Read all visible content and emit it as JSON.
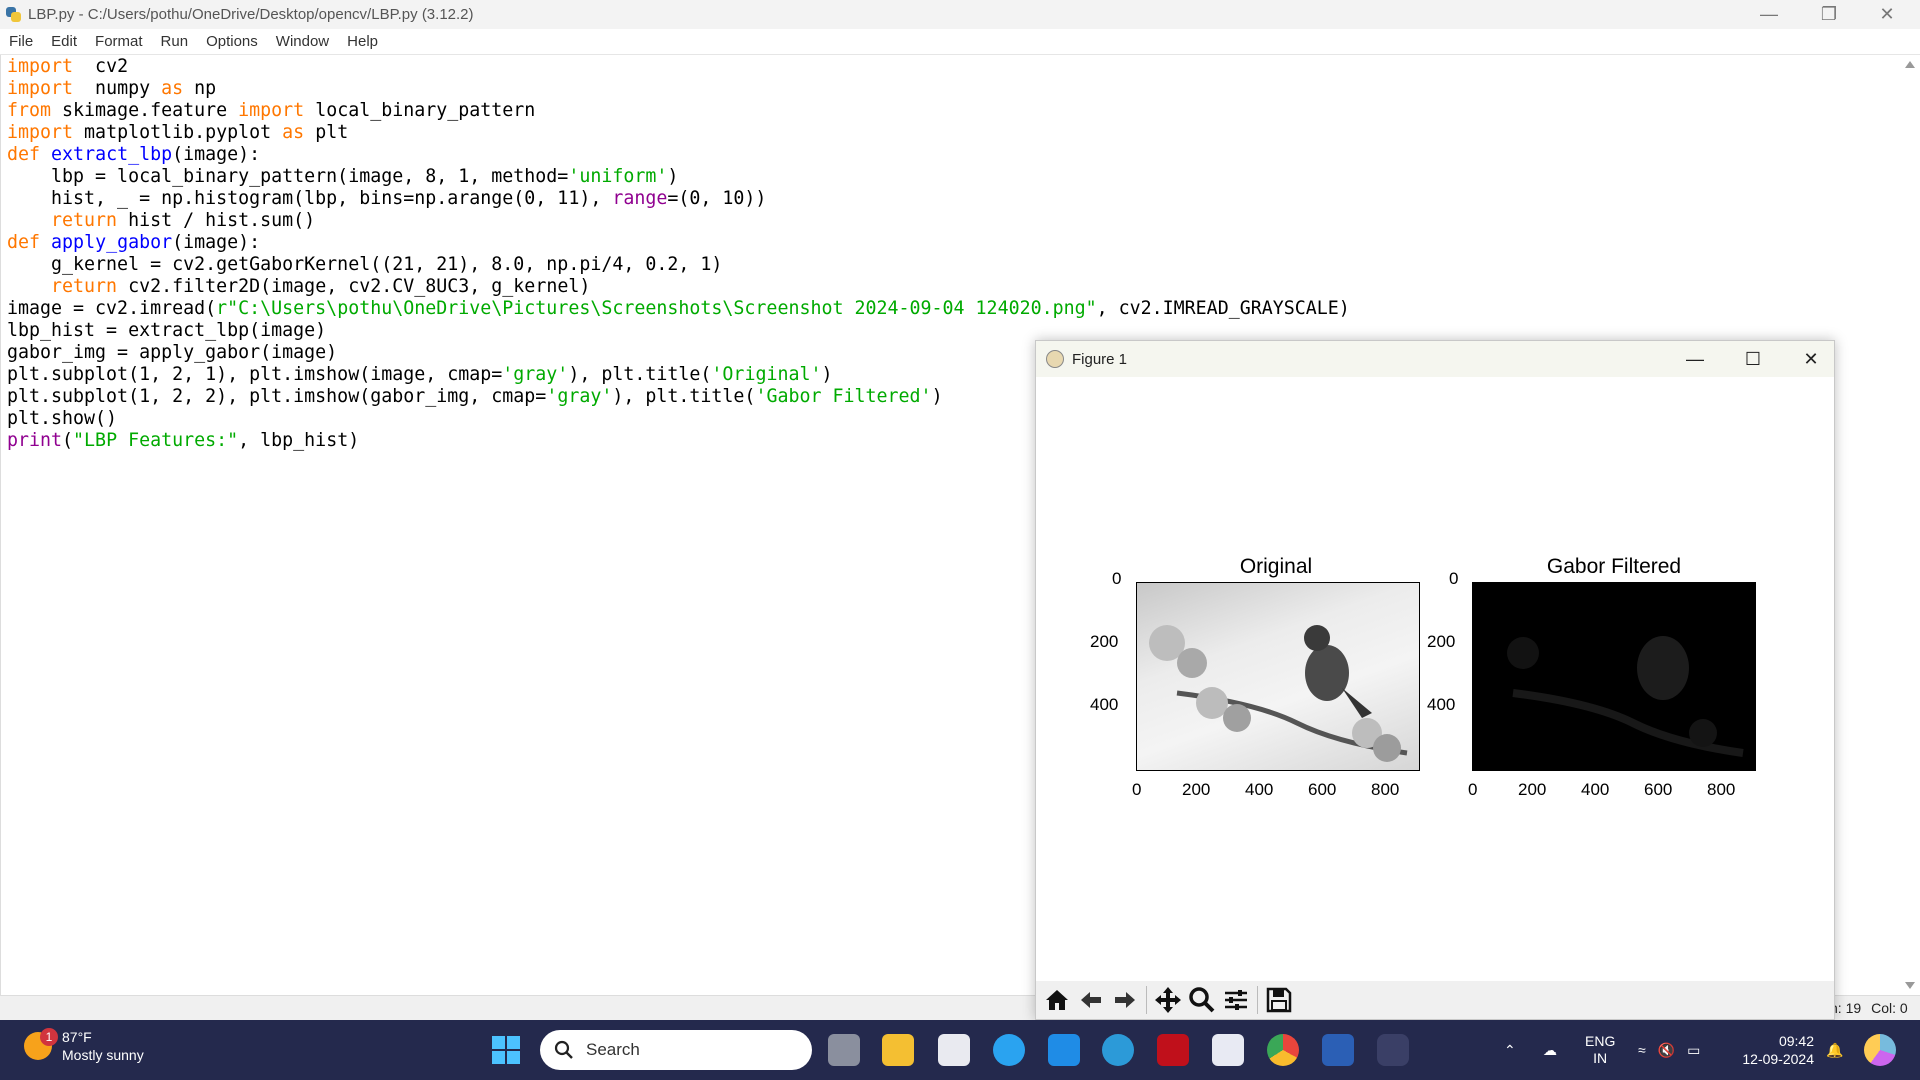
{
  "window": {
    "title": "LBP.py - C:/Users/pothu/OneDrive/Desktop/opencv/LBP.py (3.12.2)"
  },
  "menu": [
    "File",
    "Edit",
    "Format",
    "Run",
    "Options",
    "Window",
    "Help"
  ],
  "code_lines": [
    [
      [
        "kw",
        "import"
      ],
      [
        "",
        "  cv2"
      ]
    ],
    [
      [
        "kw",
        "import"
      ],
      [
        "",
        "  numpy "
      ],
      [
        "kw",
        "as"
      ],
      [
        "",
        " np"
      ]
    ],
    [
      [
        "kw",
        "from"
      ],
      [
        "",
        " skimage.feature "
      ],
      [
        "kw",
        "import"
      ],
      [
        "",
        " local_binary_pattern"
      ]
    ],
    [
      [
        "kw",
        "import"
      ],
      [
        "",
        " matplotlib.pyplot "
      ],
      [
        "kw",
        "as"
      ],
      [
        "",
        " plt"
      ]
    ],
    [
      [
        "kw",
        "def"
      ],
      [
        "",
        " "
      ],
      [
        "fn",
        "extract_lbp"
      ],
      [
        "",
        "(image):"
      ]
    ],
    [
      [
        "",
        "    lbp = local_binary_pattern(image, 8, 1, method="
      ],
      [
        "st",
        "'uniform'"
      ],
      [
        "",
        ")"
      ]
    ],
    [
      [
        "",
        "    hist, _ = np.histogram(lbp, bins=np.arange(0, 11), "
      ],
      [
        "bi",
        "range"
      ],
      [
        "",
        "=(0, 10))"
      ]
    ],
    [
      [
        "",
        "    "
      ],
      [
        "kw",
        "return"
      ],
      [
        "",
        " hist / hist.sum()"
      ]
    ],
    [
      [
        "kw",
        "def"
      ],
      [
        "",
        " "
      ],
      [
        "fn",
        "apply_gabor"
      ],
      [
        "",
        "(image):"
      ]
    ],
    [
      [
        "",
        "    g_kernel = cv2.getGaborKernel((21, 21), 8.0, np.pi/4, 0.2, 1)"
      ]
    ],
    [
      [
        "",
        "    "
      ],
      [
        "kw",
        "return"
      ],
      [
        "",
        " cv2.filter2D(image, cv2.CV_8UC3, g_kernel)"
      ]
    ],
    [
      [
        "",
        "image = cv2.imread("
      ],
      [
        "st",
        "r\"C:\\Users\\pothu\\OneDrive\\Pictures\\Screenshots\\Screenshot 2024-09-04 124020.png\""
      ],
      [
        "",
        ", cv2.IMREAD_GRAYSCALE)"
      ]
    ],
    [
      [
        "",
        "lbp_hist = extract_lbp(image)"
      ]
    ],
    [
      [
        "",
        "gabor_img = apply_gabor(image)"
      ]
    ],
    [
      [
        "",
        "plt.subplot(1, 2, 1), plt.imshow(image, cmap="
      ],
      [
        "st",
        "'gray'"
      ],
      [
        "",
        "), plt.title("
      ],
      [
        "st",
        "'Original'"
      ],
      [
        "",
        ")"
      ]
    ],
    [
      [
        "",
        "plt.subplot(1, 2, 2), plt.imshow(gabor_img, cmap="
      ],
      [
        "st",
        "'gray'"
      ],
      [
        "",
        "), plt.title("
      ],
      [
        "st",
        "'Gabor Filtered'"
      ],
      [
        "",
        ")"
      ]
    ],
    [
      [
        "",
        "plt.show()"
      ]
    ],
    [
      [
        "bi",
        "print"
      ],
      [
        "",
        "("
      ],
      [
        "st",
        "\"LBP Features:\""
      ],
      [
        "",
        ", lbp_hist)"
      ]
    ]
  ],
  "status": {
    "line": "n: 19",
    "col": "Col: 0"
  },
  "figure": {
    "title": "Figure 1",
    "plots": [
      {
        "title": "Original",
        "yticks": [
          "0",
          "200",
          "400"
        ],
        "xticks": [
          "0",
          "200",
          "400",
          "600",
          "800"
        ]
      },
      {
        "title": "Gabor Filtered",
        "yticks": [
          "0",
          "200",
          "400"
        ],
        "xticks": [
          "0",
          "200",
          "400",
          "600",
          "800"
        ]
      }
    ]
  },
  "taskbar": {
    "weather_temp": "87°F",
    "weather_desc": "Mostly sunny",
    "weather_badge": "1",
    "search_placeholder": "Search",
    "lang_top": "ENG",
    "lang_bottom": "IN",
    "time": "09:42",
    "date": "12-09-2024"
  },
  "colors": {
    "keyword": "#ff7700",
    "function": "#0000ff",
    "string": "#00aa00",
    "builtin": "#900090",
    "taskbar": "#24294d"
  }
}
